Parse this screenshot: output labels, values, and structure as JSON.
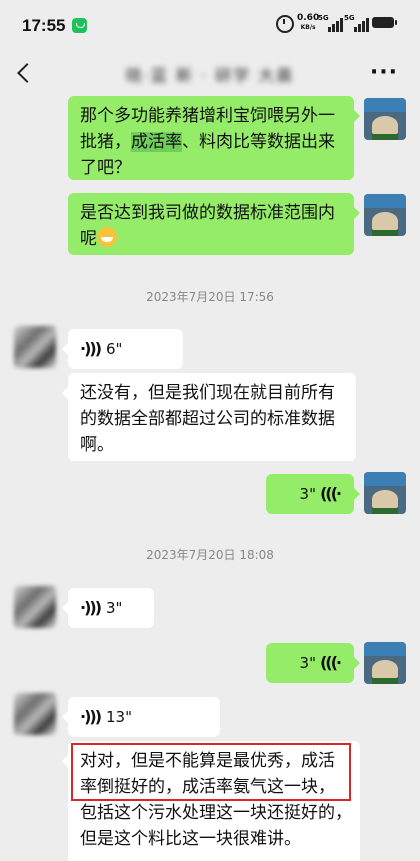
{
  "status_bar": {
    "time": "17:55",
    "speed_value": "0.60",
    "speed_unit": "KB/s",
    "signal1": "5G",
    "signal2": "5G"
  },
  "header": {
    "chat_title": "晓·蓝 新 · 研学  大晨"
  },
  "messages": [
    {
      "side": "out",
      "type": "text",
      "lines": [
        "那个多功能养猪增利宝饲喂另外一",
        "批猪，",
        "成活率",
        "、料肉比等数据出来",
        "了吧？"
      ]
    },
    {
      "side": "out",
      "type": "text",
      "lines": [
        "是否达到我司做的数据标准范围内",
        "呢"
      ]
    },
    {
      "type": "timestamp",
      "text": "2023年7月20日 17:56"
    },
    {
      "side": "in",
      "type": "voice",
      "duration": "6\""
    },
    {
      "side": "in",
      "type": "text",
      "lines": [
        "还没有，但是我们现在就目前所有",
        "的数据全部都超过公司的标准数据",
        "啊。"
      ]
    },
    {
      "side": "out",
      "type": "voice",
      "duration": "3\""
    },
    {
      "type": "timestamp",
      "text": "2023年7月20日 18:08"
    },
    {
      "side": "in",
      "type": "voice",
      "duration": "3\""
    },
    {
      "side": "out",
      "type": "voice",
      "duration": "3\""
    },
    {
      "side": "in",
      "type": "voice",
      "duration": "13\""
    },
    {
      "side": "in",
      "type": "text",
      "lines": [
        "对对，但是不能算是最优秀，成活",
        "率倒挺好的，成活率氨气这一块，",
        "包括这个污水处理这一块还挺好的，",
        "但是这个料比这一块很难讲。"
      ]
    }
  ],
  "colors": {
    "background": "#ededed",
    "outgoing_bubble": "#95ec69",
    "incoming_bubble": "#ffffff",
    "highlight_box": "#d9262b"
  }
}
